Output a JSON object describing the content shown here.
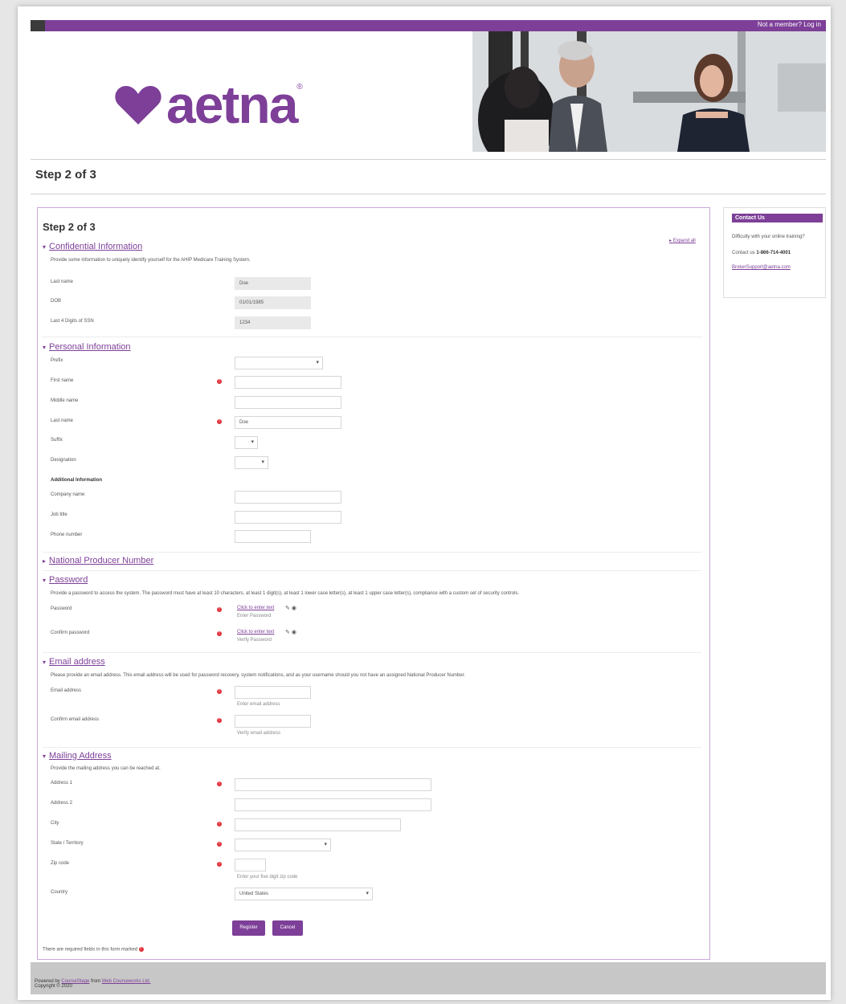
{
  "topbar": {
    "login_text": "Not a member? Log in"
  },
  "brand": {
    "name": "aetna",
    "mark": "®",
    "color": "#7d3f98"
  },
  "page": {
    "step": "Step 2 of 3"
  },
  "form": {
    "title": "Step 2 of 3",
    "expand_all": "Expand all",
    "confidential": {
      "heading": "Confidential Information",
      "description": "Provide some information to uniquely identify yourself for the AHIP Medicare Training System.",
      "last_name_label": "Last name",
      "last_name_value": "Doe",
      "dob_label": "DOB",
      "dob_value": "01/01/1985",
      "ssn_label": "Last 4 Digits of SSN",
      "ssn_value": "1234"
    },
    "personal": {
      "heading": "Personal Information",
      "prefix_label": "Prefix",
      "first_name_label": "First name",
      "middle_name_label": "Middle name",
      "last_name_label": "Last name",
      "last_name_value": "Doe",
      "suffix_label": "Suffix",
      "designation_label": "Designation",
      "additional_label": "Additional Information",
      "company_label": "Company name",
      "job_title_label": "Job title",
      "phone_label": "Phone number"
    },
    "npn": {
      "heading": "National Producer Number"
    },
    "password": {
      "heading": "Password",
      "description": "Provide a password to access the system. The password must have at least 10 characters, at least 1 digit(s), at least 1 lower case letter(s), at least 1 upper case letter(s), compliance with a custom set of security controls.",
      "password_label": "Password",
      "password_link": "Click to enter text",
      "password_hint": "Enter Password",
      "confirm_label": "Confirm password",
      "confirm_link": "Click to enter text",
      "confirm_hint": "Verify Password"
    },
    "email": {
      "heading": "Email address",
      "description": "Please provide an email address. This email address will be used for password recovery, system notifications, and as your username should you not have an assigned National Producer Number.",
      "email_label": "Email address",
      "email_hint": "Enter email address",
      "confirm_label": "Confirm email address",
      "confirm_hint": "Verify email address"
    },
    "mailing": {
      "heading": "Mailing Address",
      "description": "Provide the mailing address you can be reached at.",
      "address1_label": "Address 1",
      "address2_label": "Address 2",
      "city_label": "City",
      "state_label": "State / Territory",
      "zip_label": "Zip code",
      "zip_hint": "Enter your five digit zip code",
      "country_label": "Country",
      "country_value": "United States"
    },
    "register_label": "Register",
    "cancel_label": "Cancel",
    "required_note": "There are required fields in this form marked"
  },
  "contact": {
    "heading": "Contact Us",
    "line1": "Difficulty with your online training?",
    "phone_prefix": "Contact us",
    "phone": "1-866-714-4001",
    "email": "BrokerSupport@aetna.com"
  },
  "footer": {
    "powered_prefix": "Powered by",
    "product": "CourseStage",
    "from": "from",
    "company": "Web Courseworks Ltd.",
    "copyright": "Copyright © 2020"
  }
}
